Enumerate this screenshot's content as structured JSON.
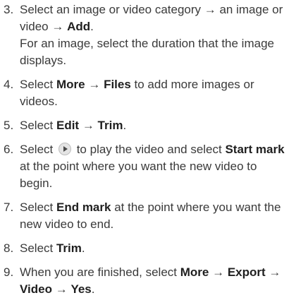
{
  "steps": [
    {
      "num": "3.",
      "parts": [
        {
          "t": "Select an image or video category → an image or video → ",
          "b": false
        },
        {
          "t": "Add",
          "b": true
        },
        {
          "t": ".",
          "b": false
        }
      ],
      "note": "For an image, select the duration that the image displays."
    },
    {
      "num": "4.",
      "parts": [
        {
          "t": "Select ",
          "b": false
        },
        {
          "t": "More",
          "b": true
        },
        {
          "t": " → ",
          "b": false
        },
        {
          "t": "Files",
          "b": true
        },
        {
          "t": " to add more images or videos.",
          "b": false
        }
      ]
    },
    {
      "num": "5.",
      "parts": [
        {
          "t": "Select ",
          "b": false
        },
        {
          "t": "Edit",
          "b": true
        },
        {
          "t": " → ",
          "b": false
        },
        {
          "t": "Trim",
          "b": true
        },
        {
          "t": ".",
          "b": false
        }
      ]
    },
    {
      "num": "6.",
      "parts": [
        {
          "t": "Select ",
          "b": false
        },
        {
          "icon": "play-icon"
        },
        {
          "t": " to play the video and select ",
          "b": false
        },
        {
          "t": "Start mark",
          "b": true
        },
        {
          "t": " at the point where you want the new video to begin.",
          "b": false
        }
      ]
    },
    {
      "num": "7.",
      "parts": [
        {
          "t": "Select ",
          "b": false
        },
        {
          "t": "End mark",
          "b": true
        },
        {
          "t": " at the point where you want the new video to end.",
          "b": false
        }
      ]
    },
    {
      "num": "8.",
      "parts": [
        {
          "t": "Select ",
          "b": false
        },
        {
          "t": "Trim",
          "b": true
        },
        {
          "t": ".",
          "b": false
        }
      ]
    },
    {
      "num": "9.",
      "parts": [
        {
          "t": "When you are finished, select ",
          "b": false
        },
        {
          "t": "More",
          "b": true
        },
        {
          "t": " → ",
          "b": false
        },
        {
          "t": "Export",
          "b": true
        },
        {
          "t": " → ",
          "b": false
        },
        {
          "t": "Video",
          "b": true
        },
        {
          "t": " → ",
          "b": false
        },
        {
          "t": "Yes",
          "b": true
        },
        {
          "t": ".",
          "b": false
        }
      ]
    }
  ]
}
